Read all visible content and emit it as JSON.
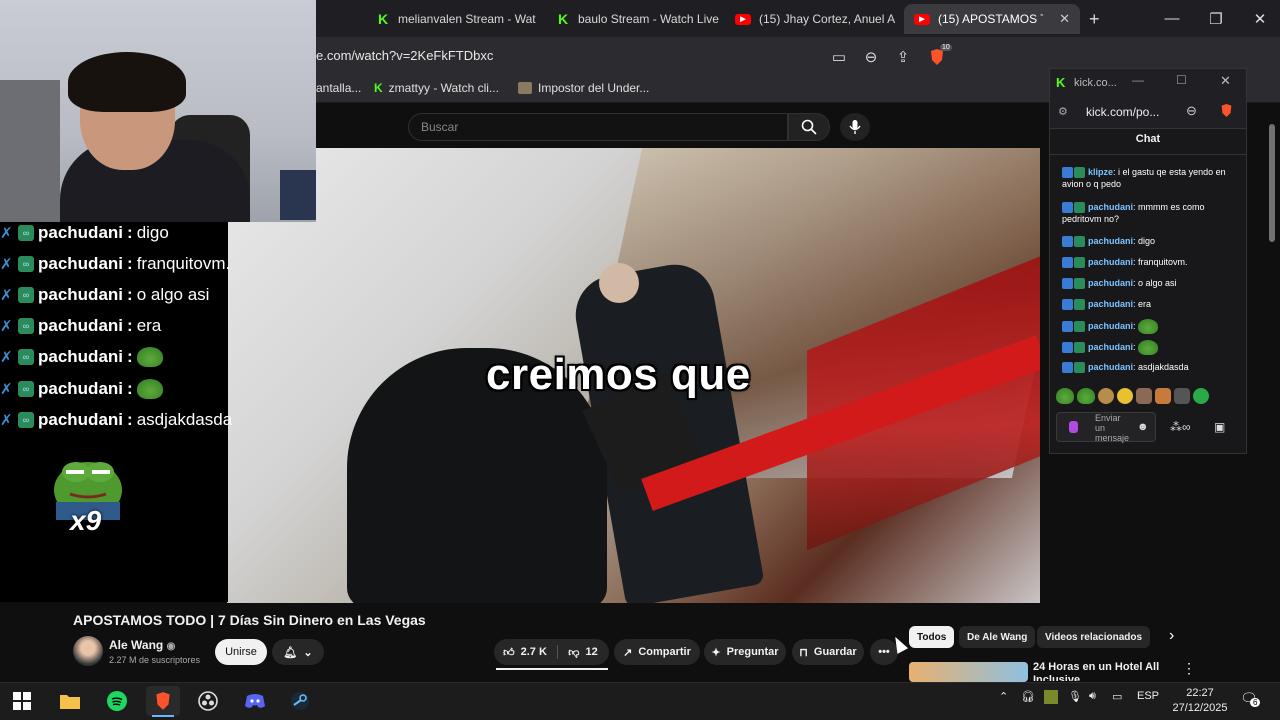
{
  "browser": {
    "tabs": [
      {
        "label": "melianvalen Stream - Watc",
        "icon": "kick-icon"
      },
      {
        "label": "baulo Stream - Watch Live",
        "icon": "kick-icon"
      },
      {
        "label": "(15) Jhay Cortez, Anuel AA",
        "icon": "youtube-icon"
      },
      {
        "label": "(15) APOSTAMOS TODO",
        "icon": "youtube-icon"
      }
    ],
    "new_tab": "+",
    "url": "e.com/watch?v=2KeFkFTDbxc",
    "brave_badge": "10",
    "bookmarks": [
      {
        "label": "antalla..."
      },
      {
        "label": "zmattyy - Watch cli..."
      },
      {
        "label": "Impostor del Under..."
      }
    ]
  },
  "youtube": {
    "search_placeholder": "Buscar",
    "caption": "creimos que",
    "video_title": "APOSTAMOS TODO | 7 Días Sin Dinero en Las Vegas",
    "channel": "Ale Wang",
    "subscribers": "2.27 M de suscriptores",
    "join": "Unirse",
    "likes": "2.7 K",
    "dislikes": "12",
    "share": "Compartir",
    "ask": "Preguntar",
    "save": "Guardar",
    "chips": [
      "Todos",
      "De Ale Wang",
      "Videos relacionados"
    ],
    "related_title": "24 Horas en un Hotel All Inclusive"
  },
  "overlay": {
    "messages": [
      {
        "user": "pachudani",
        "text": "digo"
      },
      {
        "user": "pachudani",
        "text": "franquitovm."
      },
      {
        "user": "pachudani",
        "text": "o algo asi"
      },
      {
        "user": "pachudani",
        "text": "era"
      },
      {
        "user": "pachudani",
        "text": ""
      },
      {
        "user": "pachudani",
        "text": ""
      },
      {
        "user": "pachudani",
        "text": "asdjakdasda"
      }
    ],
    "multiplier": "x9"
  },
  "kick_popup": {
    "title": "kick.co...",
    "address": "kick.com/po...",
    "brave_badge": "1",
    "header": "Chat",
    "messages": [
      {
        "user": "klipze",
        "text": "i el gastu qe esta yendo en avion o q pedo"
      },
      {
        "user": "pachudani",
        "text": "mmmm es como pedritovm no?"
      },
      {
        "user": "pachudani",
        "text": "digo"
      },
      {
        "user": "pachudani",
        "text": "franquitovm."
      },
      {
        "user": "pachudani",
        "text": "o algo asi"
      },
      {
        "user": "pachudani",
        "text": "era"
      },
      {
        "user": "pachudani",
        "text": ""
      },
      {
        "user": "pachudani",
        "text": ""
      },
      {
        "user": "pachudani",
        "text": "asdjakdasda"
      }
    ],
    "input_placeholder": "Enviar un mensaje"
  },
  "taskbar": {
    "lang": "ESP",
    "time": "22:27",
    "date": "27/12/2025",
    "notifications": "6"
  },
  "colors": {
    "kick": "#53fc18",
    "youtube": "#ff0000",
    "accent_blue": "#3ea6ff"
  }
}
